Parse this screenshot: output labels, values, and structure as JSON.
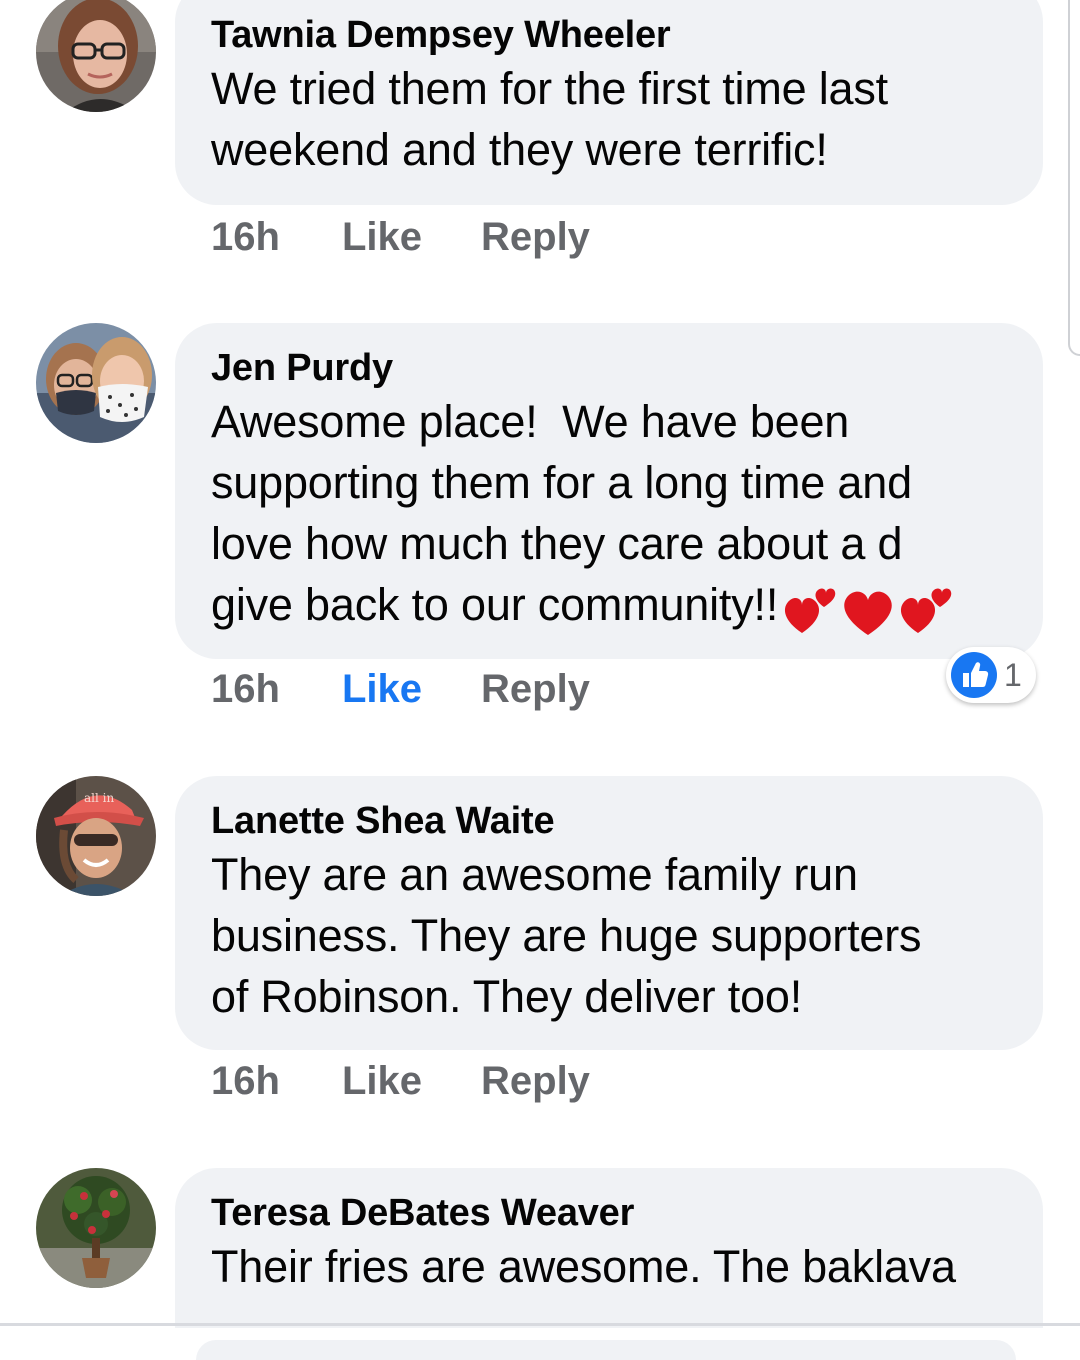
{
  "comments": [
    {
      "author": "Tawnia Dempsey Wheeler",
      "lines": [
        "We tried them for the first time last",
        "weekend and they were terrific!"
      ],
      "time": "16h",
      "like_label": "Like",
      "reply_label": "Reply",
      "liked": false,
      "avatar": "profile-photo-woman-glasses"
    },
    {
      "author": "Jen Purdy",
      "lines": [
        "Awesome place!  We have been",
        "supporting them for a long time and",
        "love how much they care about a d",
        "give back to our community!!"
      ],
      "emoji": [
        "two-hearts-emoji",
        "red-heart-emoji",
        "two-hearts-emoji"
      ],
      "time": "16h",
      "like_label": "Like",
      "reply_label": "Reply",
      "liked": true,
      "reaction": {
        "icon": "thumbs-up-icon",
        "count": "1"
      },
      "avatar": "profile-photo-two-people-masks"
    },
    {
      "author": "Lanette Shea Waite",
      "lines": [
        "They are an awesome family run",
        "business. They are huge supporters",
        "of Robinson. They deliver too!"
      ],
      "time": "16h",
      "like_label": "Like",
      "reply_label": "Reply",
      "liked": false,
      "avatar": "profile-photo-woman-red-cap",
      "avatar_cap_text": "all in"
    },
    {
      "author": "Teresa DeBates Weaver",
      "lines": [
        "Their fries are awesome. The baklava"
      ],
      "time": "",
      "liked": false,
      "avatar": "profile-photo-potted-plant"
    }
  ],
  "colors": {
    "bubble": "#f0f2f5",
    "action_text": "#65676b",
    "like_active": "#1877f2",
    "author_text": "#050505"
  }
}
